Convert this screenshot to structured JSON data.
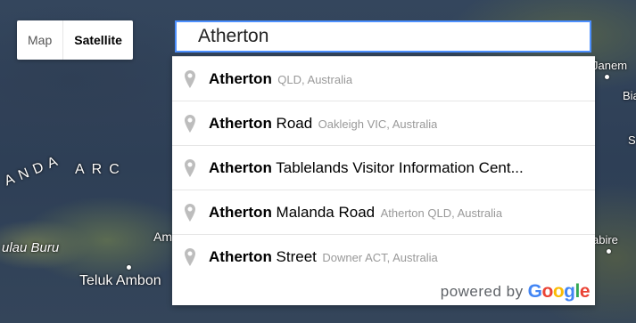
{
  "map": {
    "labels": {
      "arc_left": "ANDA",
      "arc_right": "ARC",
      "buru": "ulau Buru",
      "ambon_partial": "Am",
      "teluk_ambon": "Teluk Ambon",
      "janem": "Janem",
      "bia": "Bia",
      "s": "S",
      "abire": "abire"
    }
  },
  "map_type_control": {
    "buttons": [
      {
        "label": "Map",
        "active": false
      },
      {
        "label": "Satellite",
        "active": true
      }
    ]
  },
  "search": {
    "value": "Atherton",
    "border_color": "#4d90fe"
  },
  "autocomplete": {
    "items": [
      {
        "icon": "map-pin-icon",
        "match": "Atherton",
        "query": "",
        "secondary": "QLD, Australia"
      },
      {
        "icon": "map-pin-icon",
        "match": "Atherton",
        "query": " Road",
        "secondary": "Oakleigh VIC, Australia"
      },
      {
        "icon": "map-pin-icon",
        "match": "Atherton",
        "query": " Tablelands Visitor Information Cent...",
        "secondary": ""
      },
      {
        "icon": "map-pin-icon",
        "match": "Atherton",
        "query": " Malanda Road",
        "secondary": "Atherton QLD, Australia"
      },
      {
        "icon": "map-pin-icon",
        "match": "Atherton",
        "query": " Street",
        "secondary": "Downer ACT, Australia"
      }
    ],
    "footer": {
      "powered_by": "powered by",
      "logo_letters": [
        "G",
        "o",
        "o",
        "g",
        "l",
        "e"
      ]
    }
  }
}
